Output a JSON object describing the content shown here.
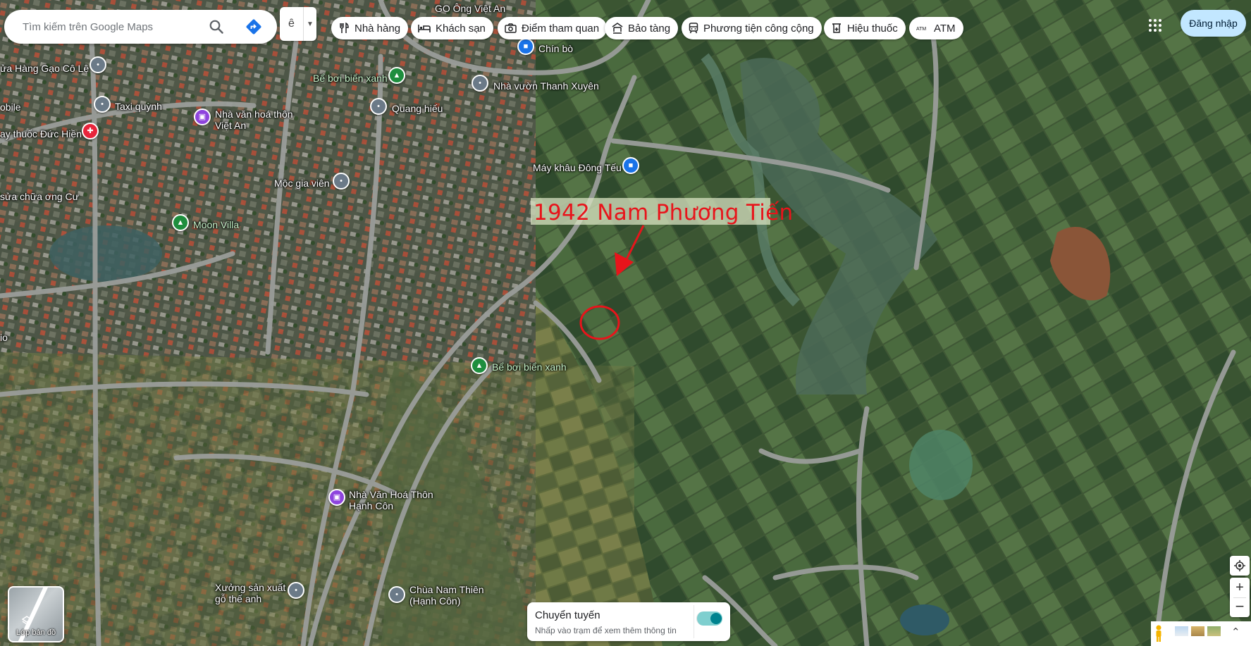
{
  "search": {
    "placeholder": "Tìm kiếm trên Google Maps",
    "search_icon": "search-icon",
    "directions_icon": "directions-icon"
  },
  "language_button": {
    "label": "ê"
  },
  "chips": [
    {
      "label": "Nhà hàng",
      "icon": "restaurant-icon"
    },
    {
      "label": "Khách sạn",
      "icon": "hotel-icon"
    },
    {
      "label": "Điểm tham quan",
      "icon": "camera-icon"
    },
    {
      "label": "Bảo tàng",
      "icon": "museum-icon"
    },
    {
      "label": "Phương tiện công cộng",
      "icon": "transit-icon"
    },
    {
      "label": "Hiệu thuốc",
      "icon": "pharmacy-icon"
    },
    {
      "label": "ATM",
      "icon": "atm-icon"
    }
  ],
  "sign_in": {
    "label": "Đăng nhập"
  },
  "annotation": {
    "label": "1942 Nam Phương Tiến",
    "color": "#e8141b"
  },
  "places": [
    {
      "name": "GO Ông Việt An",
      "kind": "none"
    },
    {
      "name": "Chín bò",
      "kind": "blue"
    },
    {
      "name": "ửa Hàng Gạo Cô Lệ",
      "kind": "gray"
    },
    {
      "name": "Bể bơi biển xanh",
      "kind": "green"
    },
    {
      "name": "Nhà vườn Thanh Xuyên",
      "kind": "gray"
    },
    {
      "name": "obile",
      "kind": "none"
    },
    {
      "name": "Taxi quỳnh",
      "kind": "gray"
    },
    {
      "name": "Quang hiếu",
      "kind": "gray"
    },
    {
      "name": "Nhà văn hoá thôn Việt An",
      "kind": "purple"
    },
    {
      "name": "ay thuốc Đức Hiền",
      "kind": "red"
    },
    {
      "name": "Máy khâu Đông Tếu",
      "kind": "blue"
    },
    {
      "name": "Mộc gia viên",
      "kind": "gray"
    },
    {
      "name": "sửa chữa ơng Cư",
      "kind": "none"
    },
    {
      "name": "Moon Villa",
      "kind": "green"
    },
    {
      "name": "Bể bơi biển xanh",
      "kind": "green"
    },
    {
      "name": "Nhà Văn Hoá Thôn Hạnh Côn",
      "kind": "purple"
    },
    {
      "name": "Xưởng sản xuất đồ gỗ thế anh",
      "kind": "gray"
    },
    {
      "name": "Chùa Nam Thiên (Hạnh Côn)",
      "kind": "gray"
    },
    {
      "name": "io",
      "kind": "none"
    }
  ],
  "layers": {
    "label": "Lớp bản đồ"
  },
  "transit_panel": {
    "title": "Chuyển tuyến",
    "subtitle": "Nhấp vào trạm để xem thêm thông tin",
    "toggle_on": true
  },
  "colors": {
    "brand_blue": "#c2e7ff",
    "annotation_red": "#e8141b",
    "transit_teal": "#00838f"
  }
}
